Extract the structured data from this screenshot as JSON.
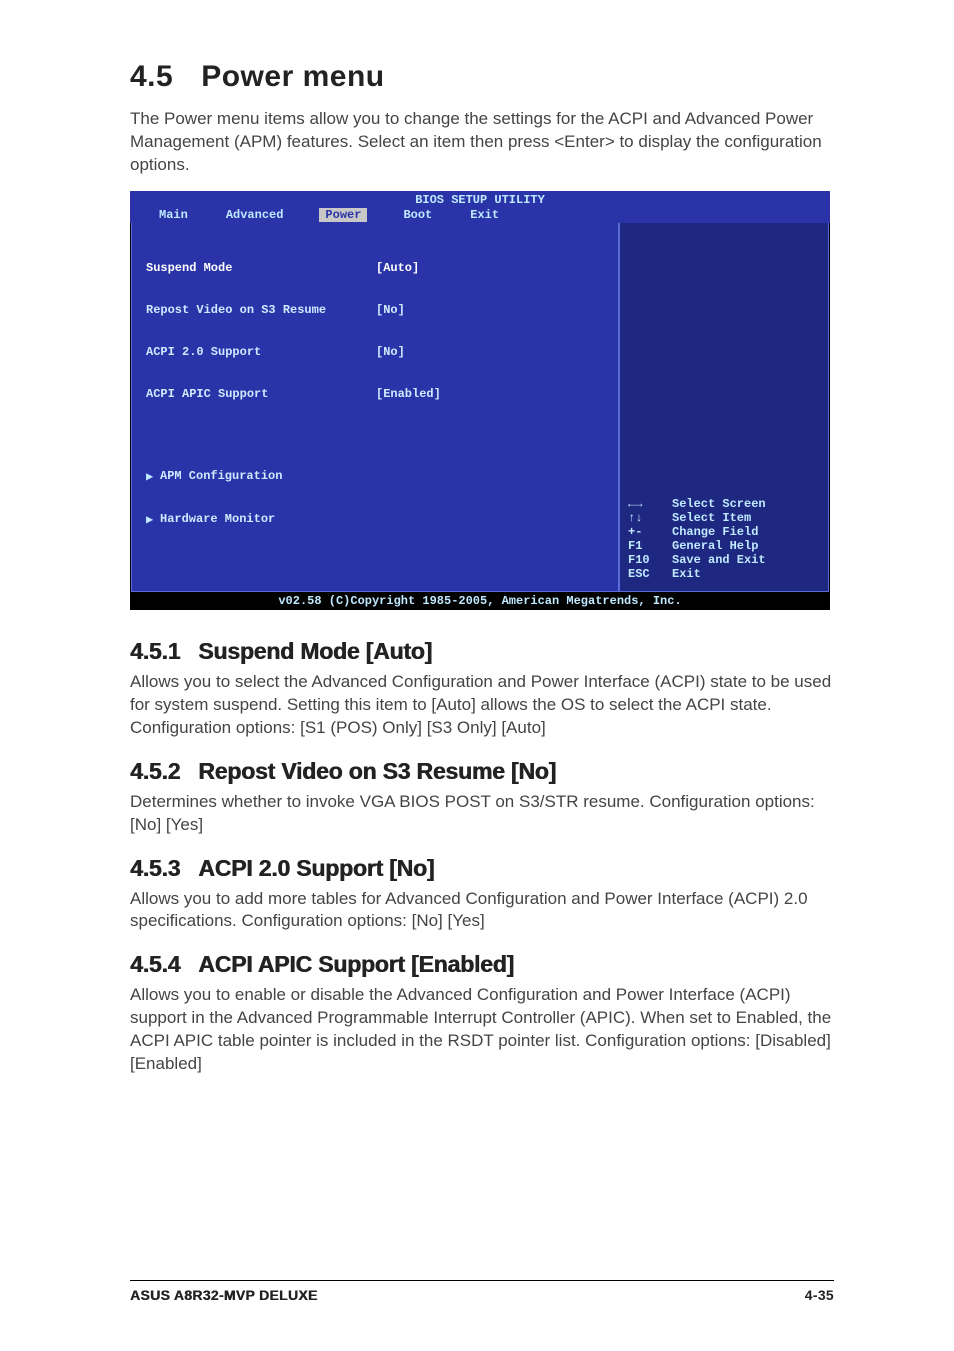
{
  "title": {
    "number": "4.5",
    "text": "Power menu"
  },
  "intro": "The Power menu items allow you to change the settings for the ACPI and Advanced Power Management (APM) features. Select an item then press <Enter> to display the configuration options.",
  "bios": {
    "utility_title": "BIOS SETUP UTILITY",
    "tabs": {
      "main": "Main",
      "advanced": "Advanced",
      "power": "Power",
      "boot": "Boot",
      "exit": "Exit"
    },
    "items": {
      "suspend": {
        "label": "Suspend Mode",
        "value": "[Auto]"
      },
      "repost": {
        "label": "Repost Video on S3 Resume",
        "value": "[No]"
      },
      "acpi20": {
        "label": "ACPI 2.0 Support",
        "value": "[No]"
      },
      "acpi_apic": {
        "label": "ACPI APIC Support",
        "value": "[Enabled]"
      }
    },
    "submenus": {
      "apm": "APM Configuration",
      "hw": "Hardware Monitor"
    },
    "help": {
      "select_screen": "Select Screen",
      "select_item": "Select Item",
      "change_field": "Change Field",
      "general_help": "General Help",
      "save_exit": "Save and Exit",
      "exit": "Exit",
      "keys": {
        "arrows_lr": "←→",
        "arrows_ud": "↑↓",
        "plusminus": "+-",
        "f1": "F1",
        "f10": "F10",
        "esc": "ESC"
      }
    },
    "copyright": "v02.58 (C)Copyright 1985-2005, American Megatrends, Inc."
  },
  "sections": {
    "s1": {
      "num": "4.5.1",
      "title": "Suspend Mode [Auto]",
      "body": "Allows you to select the Advanced Configuration and Power Interface (ACPI) state to be used for system suspend. Setting this item to [Auto] allows the OS to select the ACPI state. Configuration options: [S1 (POS) Only] [S3 Only] [Auto]"
    },
    "s2": {
      "num": "4.5.2",
      "title": "Repost Video on S3 Resume [No]",
      "body": "Determines whether to invoke VGA BIOS POST on S3/STR resume. Configuration options: [No] [Yes]"
    },
    "s3": {
      "num": "4.5.3",
      "title": "ACPI 2.0 Support [No]",
      "body": "Allows you to add more tables for Advanced Configuration and Power Interface (ACPI) 2.0 specifications. Configuration options: [No] [Yes]"
    },
    "s4": {
      "num": "4.5.4",
      "title": "ACPI APIC Support [Enabled]",
      "body": "Allows you to enable or disable the Advanced Configuration and Power Interface (ACPI) support in the Advanced Programmable Interrupt Controller (APIC). When set to Enabled, the ACPI APIC table pointer is included in the RSDT pointer list. Configuration options: [Disabled] [Enabled]"
    }
  },
  "footer": {
    "model": "ASUS A8R32-MVP DELUXE",
    "page": "4-35"
  }
}
